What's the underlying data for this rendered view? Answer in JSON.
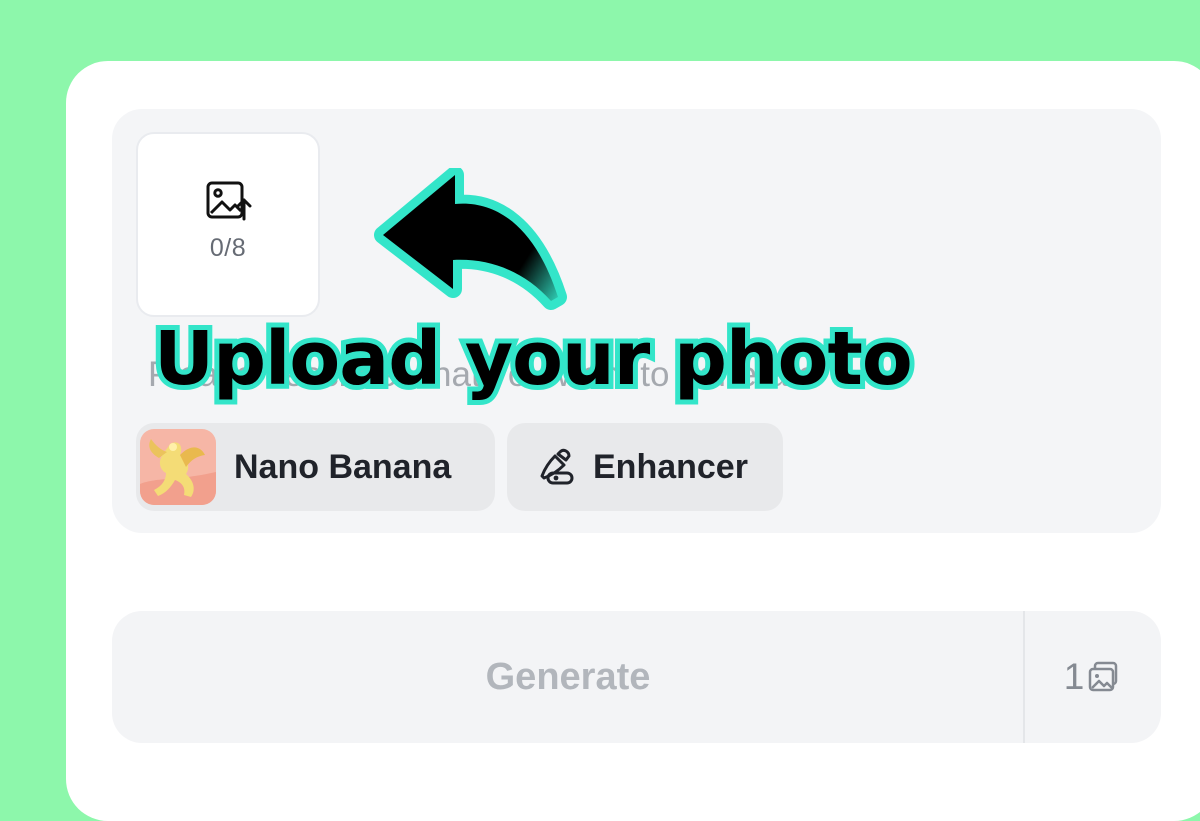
{
  "upload": {
    "icon": "image-upload-icon",
    "count_label": "0/8"
  },
  "prompt": {
    "placeholder": "Please describe what you want to generate",
    "value": ""
  },
  "annotation": {
    "text": "Upload your photo",
    "stroke_color": "#33e5c9",
    "icon": "curved-arrow-icon"
  },
  "models": [
    {
      "label": "Nano Banana",
      "icon": "banana-avatar-icon"
    },
    {
      "label": "Enhancer",
      "icon": "brush-enhancer-icon"
    }
  ],
  "generate": {
    "label": "Generate",
    "count": "1",
    "count_icon": "image-stack-icon"
  },
  "colors": {
    "background": "#8df7ab",
    "card": "#ffffff",
    "panel": "#f4f5f7",
    "annotation": "#33e5c9",
    "disabled_text": "#b2b6bc"
  }
}
